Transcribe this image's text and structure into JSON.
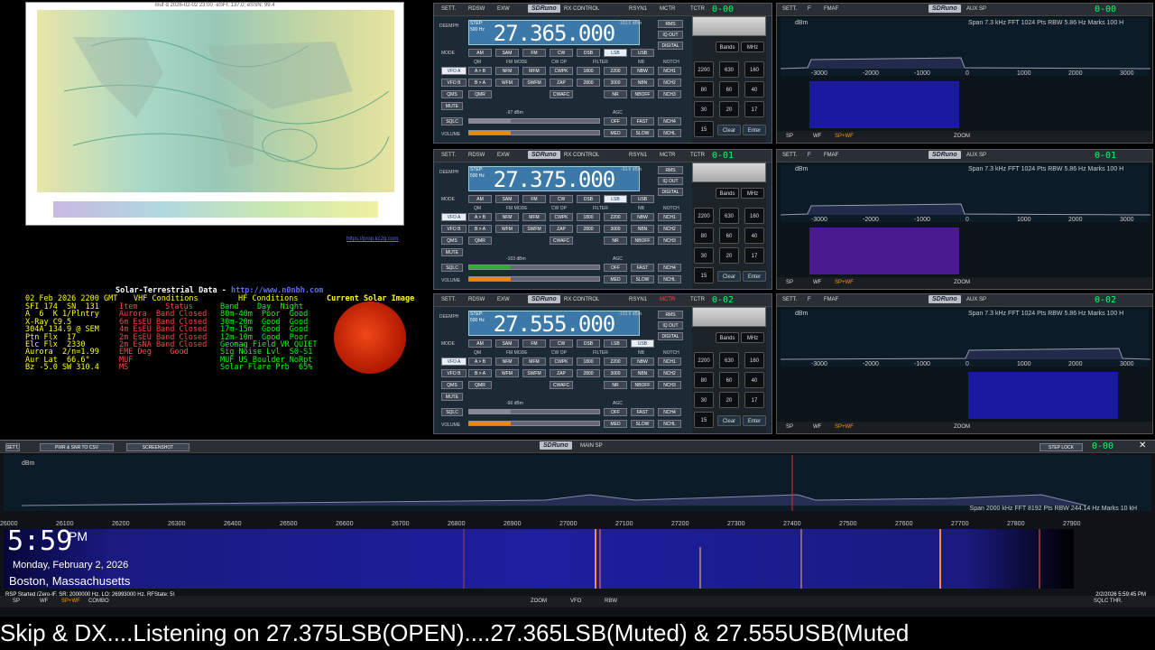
{
  "map": {
    "title": "muf·d 2026-02-02 23:00 ·eSFI: 137.0; eSSN: 99.4",
    "link": "https://prop.kc2g.com"
  },
  "solar": {
    "header": "Solar-Terrestrial Data",
    "link": "http://www.n0nbh.com",
    "date": "02 Feb 2026 2200 GMT",
    "col1": "SFI 174  SN  131\nA  6  K 1/Plntry\nX-Ray C9.5\n304A 134.9 @ SEM\nPtn Flx  17\nElc Flx  2330\nAurora  2/n=1.99\nAur Lat  66.6°\nBz -5.0 SW 310.4",
    "col2_title": "VHF Conditions",
    "col2": "Item      Status\nAurora  Band Closed\n6m EsEU Band Closed\n4m EsEU Band Closed\n2m EsEU Band Closed\n2m EsNA Band Closed\nEME Deg    Good\nMUF\nMS",
    "col3_title": "HF Conditions",
    "col3": "Band    Day  Night\n80m-40m  Poor  Good\n30m-20m  Good  Good\n17m-15m  Good  Good\n12m-10m  Good  Poor\nGeomag Field VR QUIET\nSig Noise Lvl  S0-S1\nMUF US Boulder NoRpt\nSolar Flare Prb  65%",
    "sun_title": "Current Solar Image"
  },
  "rx": [
    {
      "freq": "27.365.000",
      "dbm": "-103.6 dBm",
      "sig": "-97 dBm",
      "vfo": "0-00",
      "mode": "LSB"
    },
    {
      "freq": "27.375.000",
      "dbm": "-93.6 dBm",
      "sig": "-103 dBm",
      "vfo": "0-01",
      "mode": "LSB"
    },
    {
      "freq": "27.555.000",
      "dbm": "-103.9 dBm",
      "sig": "-96 dBm",
      "vfo": "0-02",
      "mode": "USB"
    }
  ],
  "rxlabels": {
    "sett": "SETT.",
    "rdsw": "RDSW",
    "exw": "EXW",
    "logo": "SDRuno",
    "title": "RX CONTROL",
    "rsyn": "RSYN1",
    "mctr": "MCTR",
    "tctr": "TCTR",
    "deemph": "DEEMPH",
    "step": "STEP:",
    "step_val": "500 Hz",
    "mode": "MODE",
    "vfoa": "VFO A",
    "vfob": "VFO B",
    "qms": "QMS",
    "mute": "MUTE",
    "sqlc": "SQLC",
    "volume": "VOLUME",
    "qm": "QM",
    "fmmode": "FM MODE",
    "cwop": "CW OP",
    "filter": "FILTER",
    "nb": "NB",
    "notch": "NOTCH",
    "agc": "AGC",
    "rms": "RMS",
    "iqout": "IQ OUT",
    "digital": "DIGITAL",
    "modes": [
      "AM",
      "SAM",
      "FM",
      "CW",
      "DSB",
      "LSB",
      "USB"
    ],
    "row2": [
      "A > B",
      "NFM",
      "MFM",
      "CWPK",
      "1800",
      "2200",
      "NBW",
      "NCH1"
    ],
    "row3": [
      "B > A",
      "WFM",
      "SWFM",
      "ZAP",
      "2800",
      "3000",
      "NBN",
      "NCH2"
    ],
    "row4": [
      "QMR",
      "CWAFC",
      "NR",
      "NBOFF",
      "NCH3"
    ],
    "row5": [
      "OFF",
      "FAST",
      "NCH4"
    ],
    "row6": [
      "MED",
      "SLOW",
      "NCHL"
    ],
    "keys": [
      "Bands",
      "MHz",
      "2200",
      "630",
      "160",
      "80",
      "60",
      "40",
      "30",
      "20",
      "17",
      "15",
      "Clear",
      "Enter"
    ]
  },
  "aux": {
    "sett": "SETT.",
    "f": "F",
    "fmaf": "FMAF",
    "logo": "SDRuno",
    "title": "AUX SP",
    "dbm": "dBm",
    "info": "Span 7.3 kHz  FFT 1024 Pts  RBW 5.86 Hz  Marks 100 H",
    "axis": [
      "-3000",
      "-2000",
      "-1000",
      "0",
      "1000",
      "2000",
      "3000"
    ],
    "sp": "SP",
    "wf": "WF",
    "spwf": "SP+WF",
    "zoom": "ZOOM",
    "vfos": [
      "0-00",
      "0-01",
      "0-02"
    ]
  },
  "main": {
    "sett": "SETT.",
    "pwr": "PWR & SNR TO CSV",
    "screenshot": "SCREENSHOT",
    "logo": "SDRuno",
    "title": "MAIN SP",
    "steplock": "STEP LOCK",
    "vfo": "0-00",
    "dbm": "dBm",
    "info": "Span 2000 kHz  FFT 8192 Pts  RBW 244.14 Hz  Marks 10 kH",
    "axis": [
      "26000",
      "26100",
      "26200",
      "26300",
      "26400",
      "26500",
      "26600",
      "26700",
      "26800",
      "26900",
      "27000",
      "27100",
      "27200",
      "27300",
      "27400",
      "27500",
      "27600",
      "27700",
      "27800",
      "27900"
    ],
    "status": "RSP Started (Zero-IF, SR: 2000000 Hz, LO: 26993000 Hz, RFState: 5)",
    "timestamp": "2/2/2026 5:59:45 PM",
    "sp": "SP",
    "wf": "WF",
    "spwf": "SP+WF",
    "combo": "COMBO",
    "zoom": "ZOOM",
    "vfo_btn": "VFO",
    "rbw": "RBW",
    "sqlc": "SQLC THR."
  },
  "clock": {
    "time": "5:59",
    "ampm": "PM",
    "date": "Monday, February 2, 2026",
    "city": "Boston, Massachusetts"
  },
  "ticker": "Skip & DX....Listening on 27.375LSB(OPEN)....27.365LSB(Muted) & 27.555USB(Muted"
}
